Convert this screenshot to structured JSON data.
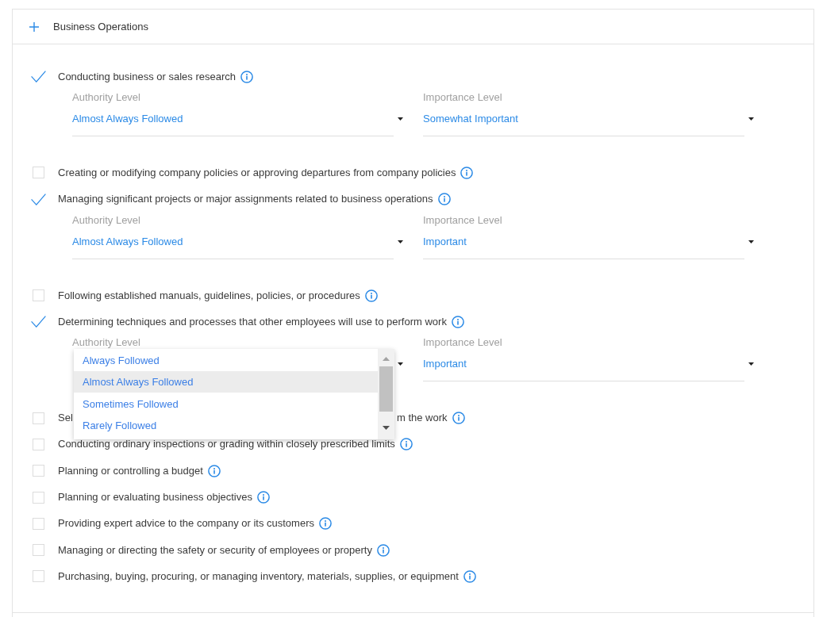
{
  "section": {
    "title": "Business Operations"
  },
  "items": [
    {
      "label": "Conducting business or sales research",
      "checked": true,
      "fields": [
        {
          "label": "Authority Level",
          "value": "Almost Always Followed"
        },
        {
          "label": "Importance Level",
          "value": "Somewhat Important"
        }
      ]
    },
    {
      "label": "Creating or modifying company policies or approving departures from company policies",
      "checked": false
    },
    {
      "label": "Managing significant projects or major assignments related to business operations",
      "checked": true,
      "fields": [
        {
          "label": "Authority Level",
          "value": "Almost Always Followed"
        },
        {
          "label": "Importance Level",
          "value": "Important"
        }
      ]
    },
    {
      "label": "Following established manuals, guidelines, policies, or procedures",
      "checked": false
    },
    {
      "label": "Determining techniques and processes that other employees will use to perform work",
      "checked": true,
      "fields": [
        {
          "label": "Authority Level",
          "open": true,
          "options": [
            {
              "label": "Always Followed",
              "selected": false
            },
            {
              "label": "Almost Always Followed",
              "selected": true
            },
            {
              "label": "Sometimes Followed",
              "selected": false
            },
            {
              "label": "Rarely Followed",
              "selected": false
            }
          ]
        },
        {
          "label": "Importance Level",
          "value": "Important"
        }
      ]
    },
    {
      "label_parts": [
        "Sel",
        "m the work"
      ],
      "checked": false
    },
    {
      "label": "Conducting ordinary inspections or grading within closely prescribed limits",
      "checked": false
    },
    {
      "label": "Planning or controlling a budget",
      "checked": false
    },
    {
      "label": "Planning or evaluating business objectives",
      "checked": false
    },
    {
      "label": "Providing expert advice to the company or its customers",
      "checked": false
    },
    {
      "label": "Managing or directing the safety or security of employees or property",
      "checked": false
    },
    {
      "label": "Purchasing, buying, procuring, or managing inventory, materials, supplies, or equipment",
      "checked": false
    }
  ]
}
